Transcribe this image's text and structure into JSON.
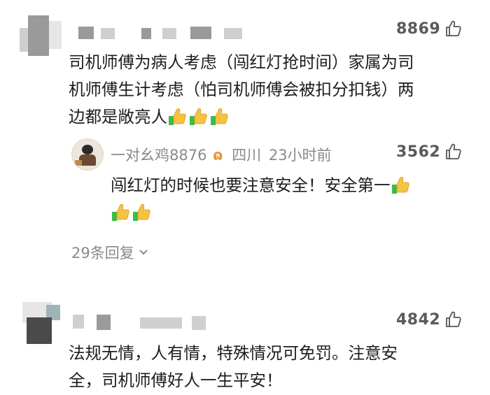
{
  "comments": [
    {
      "likes": "8869",
      "text_lines": [
        "司机师傅为病人考虑（闯红灯抢时间）家属为司",
        "机师傅生计考虑（怕司机师傅会被扣分扣钱）两",
        "边都是敞亮人"
      ],
      "emoji_count": 3,
      "reply": {
        "name": "一对幺鸡8876",
        "badge": "ɷ",
        "location": "四川",
        "time": "23小时前",
        "likes": "3562",
        "text_line1": "闯红灯的时候也要注意安全！安全第一",
        "emoji_icon": "thumbs-up-emoji"
      },
      "more_replies": "29条回复"
    },
    {
      "likes": "4842",
      "text_lines": [
        "法规无情，人有情，特殊情况可免罚。注意安",
        "全，司机师傅好人一生平安！"
      ]
    }
  ],
  "colors": {
    "text": "#1d1d1d",
    "secondary": "#8a8a8a",
    "emoji_yellow": "#f5c242",
    "emoji_green": "#3cbc4a"
  }
}
